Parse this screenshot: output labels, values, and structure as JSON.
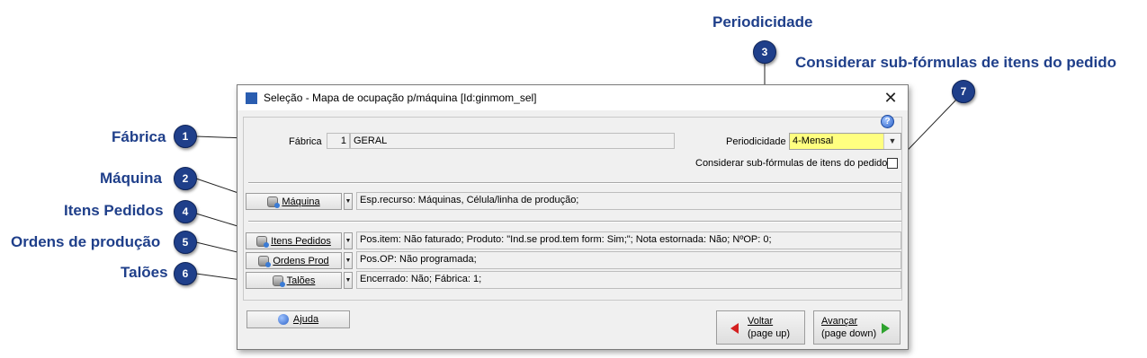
{
  "callouts": {
    "periodicidade": "Periodicidade",
    "considerar": "Considerar sub-fórmulas de itens do pedido",
    "fabrica": "Fábrica",
    "maquina": "Máquina",
    "itens_pedidos": "Itens Pedidos",
    "ordens": "Ordens de produção",
    "taloes": "Talões",
    "badges": [
      "1",
      "2",
      "3",
      "4",
      "5",
      "6",
      "7"
    ]
  },
  "dialog": {
    "title": "Seleção - Mapa de ocupação p/máquina [Id:ginmom_sel]",
    "close_glyph": "✕",
    "help_glyph": "?",
    "fabrica_label": "Fábrica",
    "fabrica_code": "1",
    "fabrica_name": "GERAL",
    "periodicidade_label": "Periodicidade",
    "periodicidade_value": "4-Mensal",
    "considerar_label": "Considerar sub-fórmulas de itens do pedido",
    "considerar_checked": false,
    "rows": [
      {
        "button_label": "Máquina",
        "filter": "Esp.recurso: Máquinas, Célula/linha de produção;"
      },
      {
        "button_label": "Itens Pedidos",
        "filter": "Pos.item: Não faturado; Produto: \"Ind.se prod.tem form: Sim;\"; Nota estornada: Não; NºOP: 0;"
      },
      {
        "button_label": "Ordens Prod",
        "filter": "Pos.OP: Não programada;"
      },
      {
        "button_label": "Talões",
        "filter": "Encerrado: Não; Fábrica: 1;"
      }
    ],
    "ajuda_label": "Ajuda",
    "voltar_line1": "Voltar",
    "voltar_line2": "(page up)",
    "avancar_line1": "Avançar",
    "avancar_line2": "(page down)"
  },
  "icons": {
    "app": "app-icon",
    "db": "database-icon",
    "help": "help-icon",
    "back": "arrow-left-icon",
    "forward": "arrow-right-icon"
  },
  "colors": {
    "callout": "#1f3f8a",
    "combo_bg": "#ffff80"
  }
}
